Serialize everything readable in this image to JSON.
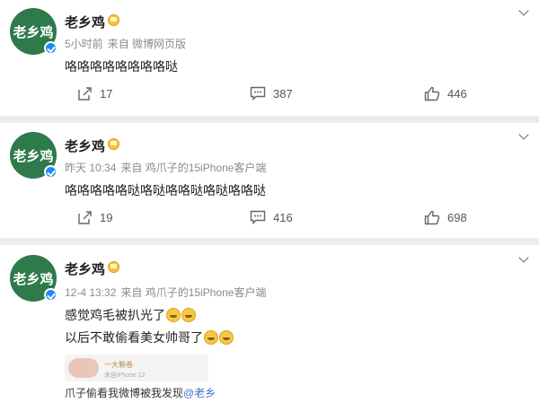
{
  "posts": [
    {
      "author": "老乡鸡",
      "avatar_text": "老乡鸡",
      "time": "5小时前",
      "source": "来自 微博网页版",
      "text": "咯咯咯咯咯咯咯咯哒",
      "reposts": "17",
      "comments": "387",
      "likes": "446"
    },
    {
      "author": "老乡鸡",
      "avatar_text": "老乡鸡",
      "time": "昨天 10:34",
      "source": "来自 鸡爪子的15iPhone客户端",
      "text": "咯咯咯咯咯哒咯哒咯咯哒咯哒咯咯哒",
      "reposts": "19",
      "comments": "416",
      "likes": "698"
    },
    {
      "author": "老乡鸡",
      "avatar_text": "老乡鸡",
      "time": "12-4 13:32",
      "source": "来自 鸡爪子的15iPhone客户端",
      "line1": "感觉鸡毛被扒光了",
      "line2": "以后不敢偷看美女帅哥了",
      "thumb_name": "一大颗卷",
      "thumb_source": "来自iPhone 12",
      "caption": "爪子偷看我微博被我发现",
      "caption_mention": "@老乡"
    }
  ],
  "icons": {
    "repost": "repost-icon",
    "comment": "comment-icon",
    "like": "like-icon",
    "more": "chevron-down-icon",
    "verified": "verified-badge-icon",
    "vip": "crown-icon",
    "emoji": "crying-face-icon"
  },
  "colors": {
    "avatar_bg": "#2e7a4b",
    "verified": "#1f8bf0",
    "mention": "#3c74c7",
    "meta_text": "#8b8b8b"
  }
}
